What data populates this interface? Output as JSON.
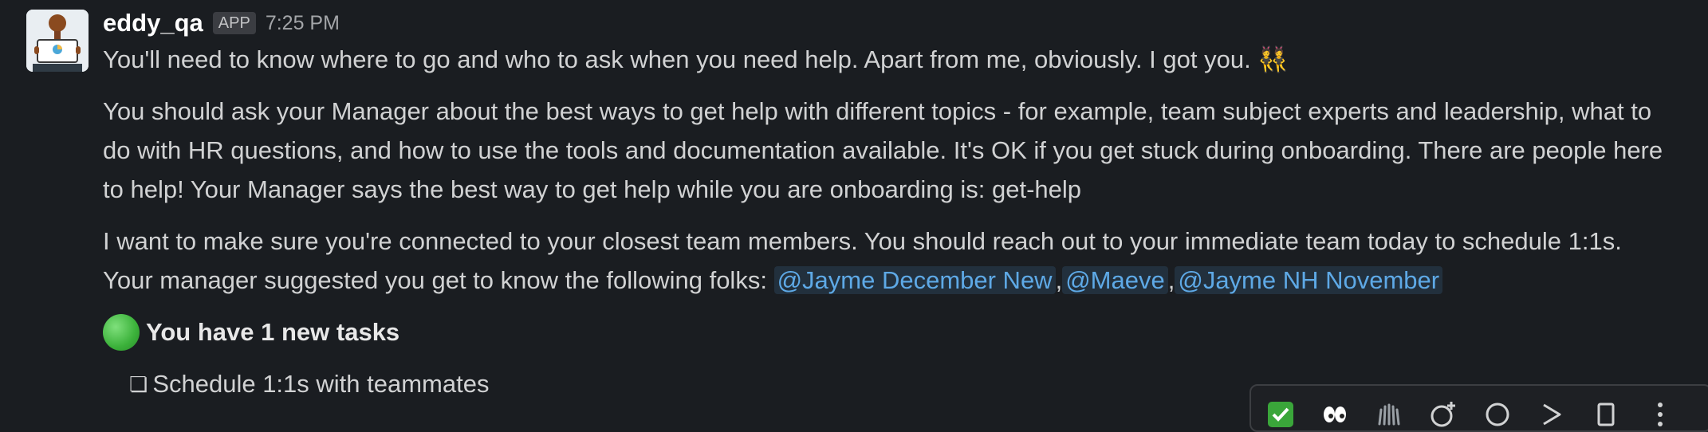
{
  "message": {
    "username": "eddy_qa",
    "badge": "APP",
    "timestamp": "7:25 PM",
    "para1": "You'll need to know where to go and who to ask when you need help. Apart from me, obviously. I got you. 👯",
    "para2": "You should ask your Manager about the best ways to get help with different topics - for example, team subject experts and leadership, what to do with HR questions, and how to use the tools and documentation available. It's OK if you get stuck during onboarding. There are people here to help! Your Manager says the best way to get help while you are onboarding is: get-help",
    "para3_prefix": "I want to make sure you're connected to your closest team members. You should reach out to your immediate team today to schedule 1:1s. Your manager suggested you get to know the following folks:",
    "mentions": [
      "@Jayme December New",
      "@Maeve",
      "@Jayme NH November"
    ],
    "separator": ",",
    "tasks_heading": "You have 1 new tasks",
    "task_checkbox": "❏",
    "task_item": "Schedule 1:1s with teammates"
  },
  "colors": {
    "background": "#1a1d21",
    "mention_text": "#5ea9e6",
    "mention_bg": "#22303d",
    "status_green": "#3bb13a"
  },
  "icons": {
    "avatar": "presenter-avatar-icon",
    "status": "green-circle-icon",
    "toolbar": [
      "checkmark-reaction-icon",
      "eyes-reaction-icon",
      "raised-hands-reaction-icon",
      "add-reaction-icon",
      "reply-thread-icon",
      "forward-icon",
      "bookmark-icon",
      "more-actions-icon"
    ]
  }
}
